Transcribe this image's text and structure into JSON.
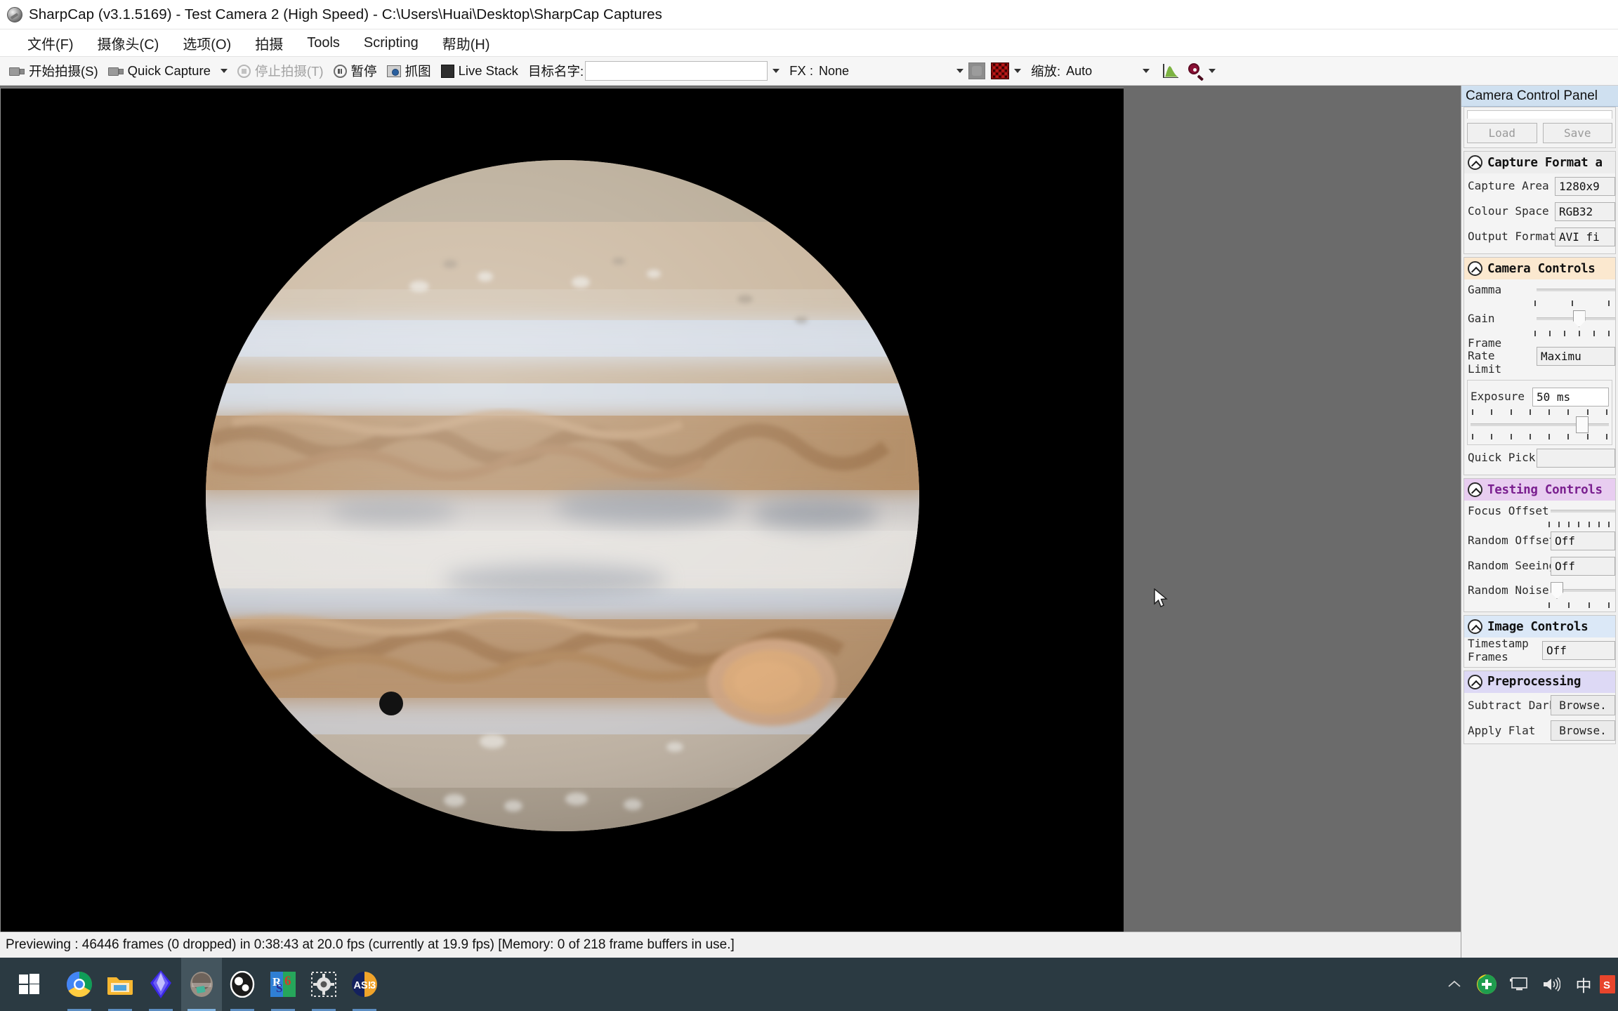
{
  "window": {
    "title": "SharpCap (v3.1.5169) - Test Camera 2 (High Speed) - C:\\Users\\Huai\\Desktop\\SharpCap Captures",
    "app_icon": "sharpcap-icon"
  },
  "menu": {
    "items": [
      {
        "label": "文件(F)",
        "name": "menu-file"
      },
      {
        "label": "摄像头(C)",
        "name": "menu-camera"
      },
      {
        "label": "选项(O)",
        "name": "menu-options"
      },
      {
        "label": "拍摄",
        "name": "menu-capture"
      },
      {
        "label": "Tools",
        "name": "menu-tools"
      },
      {
        "label": "Scripting",
        "name": "menu-scripting"
      },
      {
        "label": "帮助(H)",
        "name": "menu-help"
      }
    ]
  },
  "toolbar": {
    "start_capture": "开始拍摄(S)",
    "quick_capture": "Quick Capture",
    "stop_capture": "停止拍摄(T)",
    "pause": "暂停",
    "snapshot": "抓图",
    "live_stack": "Live Stack",
    "target_name_label": "目标名字:",
    "target_name_value": "",
    "fx_label": "FX :",
    "fx_value": "None",
    "zoom_label": "缩放:",
    "zoom_value": "Auto",
    "histogram_icon": "histogram-icon",
    "zoom_glass_icon": "zoom-magnifier-icon"
  },
  "dock": {
    "header": "Camera Control Panel",
    "load_button": "Load",
    "save_button": "Save",
    "groups": [
      {
        "name": "capture-format",
        "title": "Capture Format a",
        "rows": [
          {
            "label": "Capture Area",
            "value": "1280x9"
          },
          {
            "label": "Colour Space",
            "value": "RGB32"
          },
          {
            "label": "Output Format",
            "value": "AVI fi"
          }
        ]
      },
      {
        "name": "camera-controls",
        "title": "Camera Controls",
        "rows": [
          {
            "label": "Gamma",
            "value": ""
          },
          {
            "label": "Gain",
            "value": ""
          },
          {
            "label": "Frame Rate\nLimit",
            "value": "Maximu"
          },
          {
            "label": "Exposure",
            "value": "50 ms"
          },
          {
            "label": "Quick Picks",
            "value": ""
          }
        ]
      },
      {
        "name": "testing-controls",
        "title": "Testing Controls",
        "rows": [
          {
            "label": "Focus Offset",
            "value": ""
          },
          {
            "label": "Random Offset",
            "value": "Off"
          },
          {
            "label": "Random Seeing",
            "value": "Off"
          },
          {
            "label": "Random Noise",
            "value": ""
          }
        ]
      },
      {
        "name": "image-controls",
        "title": "Image Controls",
        "rows": [
          {
            "label": "Timestamp\nFrames",
            "value": "Off"
          }
        ]
      },
      {
        "name": "preprocessing",
        "title": "Preprocessing",
        "rows": [
          {
            "label": "Subtract Dark",
            "value": "Browse."
          },
          {
            "label": "Apply Flat",
            "value": "Browse."
          }
        ]
      }
    ]
  },
  "status": {
    "text": "Previewing : 46446 frames (0 dropped) in 0:38:43 at 20.0 fps  (currently at 19.9 fps) [Memory: 0 of 218 frame buffers in use.]"
  },
  "taskbar": {
    "items": [
      {
        "name": "start-button-icon",
        "label": "Start"
      },
      {
        "name": "chrome-icon",
        "label": "Google Chrome"
      },
      {
        "name": "file-explorer-icon",
        "label": "File Explorer"
      },
      {
        "name": "diamond-app-icon",
        "label": "Diamond App"
      },
      {
        "name": "sharpcap-taskbar-icon",
        "label": "SharpCap"
      },
      {
        "name": "obs-icon",
        "label": "OBS Studio"
      },
      {
        "name": "registax-icon",
        "label": "RS6"
      },
      {
        "name": "gear-app-icon",
        "label": "Settings App"
      },
      {
        "name": "autostakkert-icon",
        "label": "AS!3"
      }
    ],
    "tray": [
      {
        "name": "show-hidden-icons-chevron-icon",
        "glyph": "⌃"
      },
      {
        "name": "antivirus-shield-icon",
        "glyph": ""
      },
      {
        "name": "network-monitor-icon",
        "glyph": ""
      },
      {
        "name": "volume-speaker-icon",
        "glyph": ""
      },
      {
        "name": "ime-chinese-icon",
        "glyph": "中"
      },
      {
        "name": "notification-app-icon",
        "glyph": ""
      }
    ]
  },
  "colors": {
    "accent": "#2b3a42",
    "dock_header": "#cfe0f0",
    "camera_group": "#fbe8cf",
    "testing_group": "#e8cdf0",
    "testing_text": "#7a1f8f",
    "image_group": "#dbe8f7",
    "prep_group": "#ddd9f5",
    "canvas_bg": "#000000",
    "workspace_bg": "#6b6b6b"
  },
  "scene": {
    "subject": "Jupiter",
    "features": [
      "north-polar-region",
      "north-equatorial-belt",
      "equatorial-zone",
      "south-equatorial-belt",
      "great-red-spot",
      "moon-shadow-transit",
      "south-polar-region"
    ]
  }
}
